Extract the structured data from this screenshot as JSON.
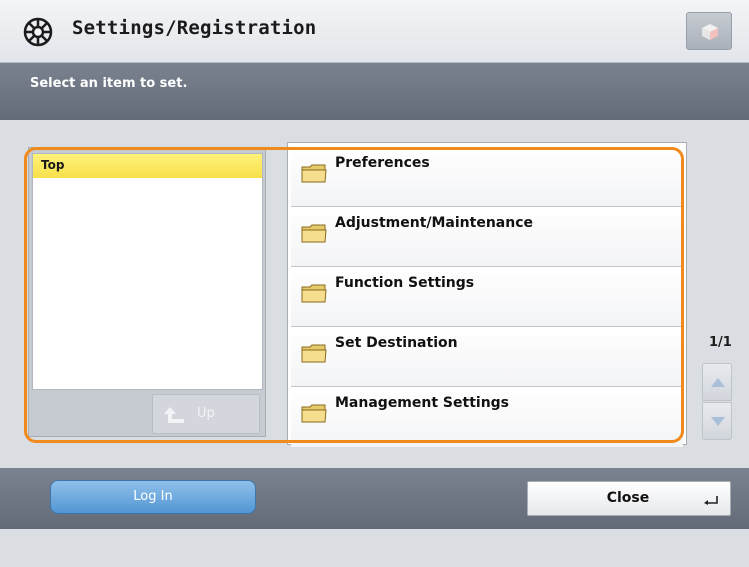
{
  "header": {
    "title": "Settings/Registration"
  },
  "message": {
    "text": "Select an item to set."
  },
  "tree": {
    "selected_item": "Top",
    "up_label": "Up"
  },
  "items": [
    {
      "label": "Preferences",
      "icon": "folder-icon"
    },
    {
      "label": "Adjustment/Maintenance",
      "icon": "folder-icon"
    },
    {
      "label": "Function Settings",
      "icon": "folder-icon"
    },
    {
      "label": "Set Destination",
      "icon": "folder-icon"
    },
    {
      "label": "Management Settings",
      "icon": "folder-icon"
    }
  ],
  "pagination": {
    "indicator": "1/1"
  },
  "footer": {
    "login_label": "Log In",
    "close_label": "Close"
  },
  "colors": {
    "highlight": "#f08a1c",
    "selected_tree_item": "#f7e04a",
    "login_button": "#5296d4",
    "message_bar": "#6e7583"
  }
}
